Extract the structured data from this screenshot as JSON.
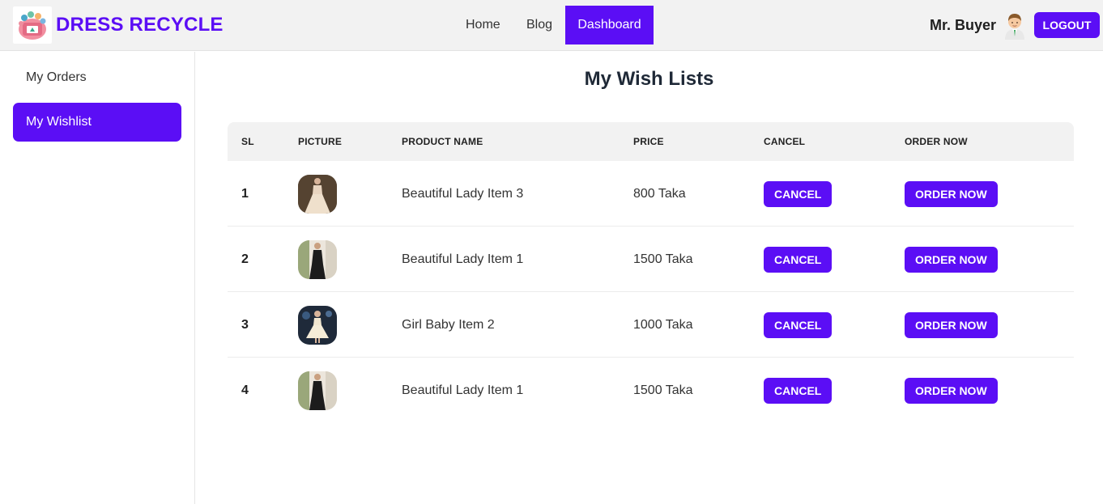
{
  "brand": {
    "name": "DRESS RECYCLE"
  },
  "nav": {
    "links": [
      "Home",
      "Blog",
      "Dashboard"
    ],
    "active": "Dashboard"
  },
  "user": {
    "name": "Mr. Buyer",
    "logout_label": "LOGOUT"
  },
  "sidebar": {
    "items": [
      {
        "label": "My Orders",
        "active": false
      },
      {
        "label": "My Wishlist",
        "active": true
      }
    ]
  },
  "page": {
    "title": "My Wish Lists"
  },
  "table": {
    "columns": [
      "SL",
      "PICTURE",
      "PRODUCT NAME",
      "PRICE",
      "CANCEL",
      "ORDER NOW"
    ],
    "rows": [
      {
        "sl": "1",
        "name": "Beautiful Lady Item 3",
        "price": "800 Taka",
        "cancel": "CANCEL",
        "order": "ORDER NOW"
      },
      {
        "sl": "2",
        "name": "Beautiful Lady Item 1",
        "price": "1500 Taka",
        "cancel": "CANCEL",
        "order": "ORDER NOW"
      },
      {
        "sl": "3",
        "name": "Girl Baby Item 2",
        "price": "1000 Taka",
        "cancel": "CANCEL",
        "order": "ORDER NOW"
      },
      {
        "sl": "4",
        "name": "Beautiful Lady Item 1",
        "price": "1500 Taka",
        "cancel": "CANCEL",
        "order": "ORDER NOW"
      }
    ]
  },
  "colors": {
    "accent": "#5b0ef5",
    "header_bg": "#f2f2f2"
  }
}
